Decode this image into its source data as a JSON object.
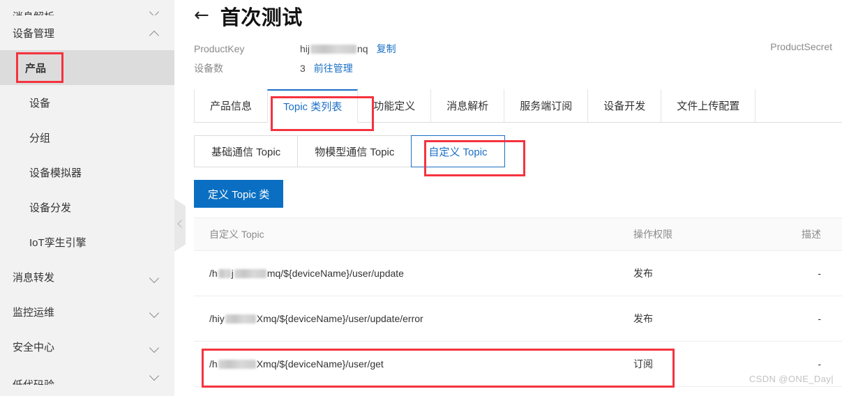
{
  "sidebar": {
    "groups": [
      {
        "label": "消息解析",
        "state": "clipped-top",
        "chevron": "chevron-down-icon"
      },
      {
        "label": "设备管理",
        "state": "expanded",
        "chevron": "chevron-up-icon"
      },
      {
        "label": "消息转发",
        "state": "collapsed",
        "chevron": "chevron-down-icon"
      },
      {
        "label": "监控运维",
        "state": "collapsed",
        "chevron": "chevron-down-icon"
      },
      {
        "label": "安全中心",
        "state": "collapsed",
        "chevron": "chevron-down-icon"
      },
      {
        "label": "低代码验",
        "state": "clipped-bottom",
        "chevron": "chevron-down-icon"
      }
    ],
    "items": [
      {
        "label": "产品",
        "active": true
      },
      {
        "label": "设备",
        "active": false
      },
      {
        "label": "分组",
        "active": false
      },
      {
        "label": "设备模拟器",
        "active": false
      },
      {
        "label": "设备分发",
        "active": false
      },
      {
        "label": "IoT孪生引擎",
        "active": false
      }
    ]
  },
  "header": {
    "back_icon": "back-arrow-icon",
    "title": "首次测试",
    "product_key_label": "ProductKey",
    "product_key_prefix": "hij",
    "product_key_suffix": "nq",
    "copy_label": "复制",
    "device_count_label": "设备数",
    "device_count_value": "3",
    "goto_manage_label": "前往管理",
    "product_secret_label": "ProductSecret"
  },
  "tabs": [
    {
      "label": "产品信息",
      "active": false
    },
    {
      "label": "Topic 类列表",
      "active": true,
      "highlight": true
    },
    {
      "label": "功能定义",
      "active": false
    },
    {
      "label": "消息解析",
      "active": false
    },
    {
      "label": "服务端订阅",
      "active": false
    },
    {
      "label": "设备开发",
      "active": false
    },
    {
      "label": "文件上传配置",
      "active": false
    }
  ],
  "subtabs": [
    {
      "label": "基础通信 Topic",
      "active": false
    },
    {
      "label": "物模型通信 Topic",
      "active": false
    },
    {
      "label": "自定义 Topic",
      "active": true,
      "highlight": true
    }
  ],
  "toolbar": {
    "define_topic_button": "定义 Topic 类"
  },
  "table": {
    "columns": [
      "自定义 Topic",
      "操作权限",
      "描述"
    ],
    "rows": [
      {
        "topic_prefix": "/h",
        "topic_mid": "j",
        "topic_suffix": "mq/${deviceName}/user/update",
        "permission": "发布",
        "description": "-",
        "highlight": false
      },
      {
        "topic_prefix": "/hiy",
        "topic_mid": "",
        "topic_suffix": "Xmq/${deviceName}/user/update/error",
        "permission": "发布",
        "description": "-",
        "highlight": false
      },
      {
        "topic_prefix": "/h",
        "topic_mid": "",
        "topic_suffix": "Xmq/${deviceName}/user/get",
        "permission": "订阅",
        "description": "-",
        "highlight": true
      }
    ]
  },
  "watermark": "CSDN @ONE_Day|",
  "colors": {
    "accent": "#1a6fc4",
    "primary_button": "#0a6fc2",
    "highlight_box": "#f5333f",
    "sidebar_bg": "#f2f2f2",
    "sidebar_active_bg": "#dcdcdc",
    "table_header_bg": "#fafafa"
  }
}
